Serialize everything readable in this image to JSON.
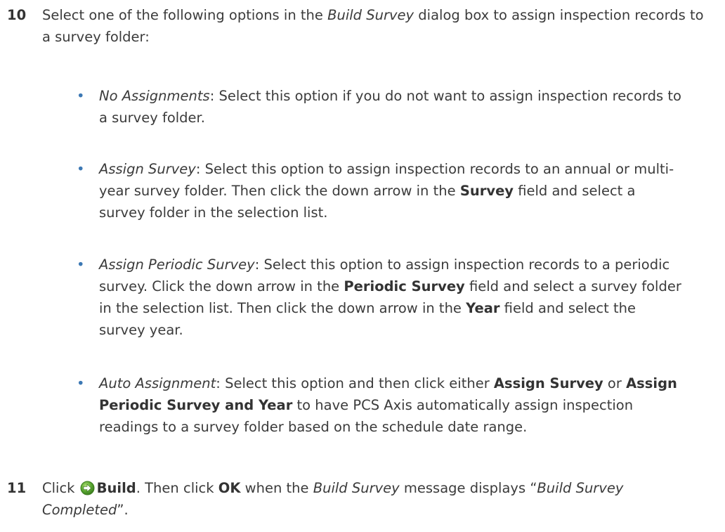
{
  "step10": {
    "number": "10",
    "intro_before": "Select one of the following options in the ",
    "intro_dialog": "Build Survey",
    "intro_after": " dialog box to assign inspection records to a survey folder:"
  },
  "bullets": [
    {
      "term": "No Assignments",
      "text": ":  Select this option if you do not want to assign inspection records to a survey folder."
    },
    {
      "term": "Assign Survey",
      "text_a": ":  Select this option to assign inspection records to an annual or multi-year survey folder. Then click the down arrow in the ",
      "bold_a": "Survey",
      "text_b": " field and select a survey folder in the selection list."
    },
    {
      "term": "Assign Periodic Survey",
      "text_a": ":  Select this option to assign inspection records to a periodic survey. Click the down arrow in the ",
      "bold_a": "Periodic Survey",
      "text_b": " field and select a survey folder in the selection list. Then click the down arrow in the ",
      "bold_b": "Year",
      "text_c": " field and select the survey year."
    },
    {
      "term": "Auto Assignment",
      "text_a": ":  Select this option and then click either ",
      "bold_a": "Assign Survey",
      "text_b": " or ",
      "bold_b": "Assign Periodic Survey and Year",
      "text_c": " to have PCS Axis automatically assign inspection readings to a survey folder based on the schedule date range."
    }
  ],
  "bullet_glyph": "•",
  "step11": {
    "number": "11",
    "click": "Click ",
    "build_label": "Build",
    "then_click": ". Then click ",
    "ok_label": "OK",
    "when": " when the ",
    "dialog": "Build Survey",
    "message_displays": " message displays “",
    "completed": "Build Survey Completed",
    "end": "”."
  },
  "icons": {
    "build": "build-icon"
  },
  "colors": {
    "text": "#3b3b3b",
    "bullet": "#3c78b4",
    "icon_green": "#5aa832"
  }
}
